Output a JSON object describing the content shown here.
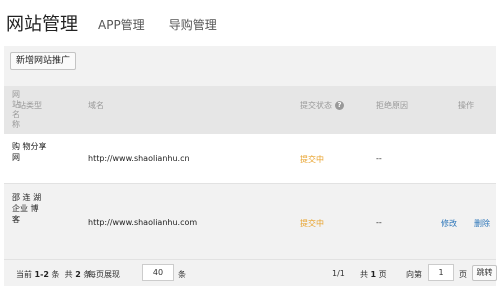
{
  "tabs": {
    "active": "网站管理",
    "app": "APP管理",
    "shop": "导购管理"
  },
  "toolbar": {
    "add_label": "新增网站推广"
  },
  "table": {
    "headers": {
      "type_head": "网 站 名 称",
      "type_tail": "站类型",
      "domain": "域名",
      "status": "提交状态",
      "reason": "拒绝原因",
      "ops": "操作"
    },
    "rows": [
      {
        "type": "购 物分享 网",
        "domain": "http://www.shaolianhu.cn",
        "status": "提交中",
        "reason": "--"
      },
      {
        "type": "邵 连 湖 企业 博 客",
        "domain": "http://www.shaolianhu.com",
        "status": "提交中",
        "reason": "--",
        "edit": "修改",
        "delete": "删除"
      }
    ]
  },
  "status_color": "#e8a22b",
  "link_color": "#2a74b8",
  "pagination": {
    "current_prefix": "当前",
    "current_range": "1-2",
    "current_suffix": "条",
    "total_prefix": "共",
    "total_count": "2",
    "total_suffix": "条",
    "per_page_label": "每页展现",
    "per_page_value": "40",
    "per_page_unit": "条",
    "page_indicator": "1/1",
    "total_pages_prefix": "共",
    "total_pages": "1",
    "total_pages_suffix": "页",
    "goto_label": "向第",
    "goto_value": "1",
    "goto_unit": "页",
    "jump_label": "跳转"
  },
  "icons": {
    "status_help": "question-circle-icon"
  }
}
